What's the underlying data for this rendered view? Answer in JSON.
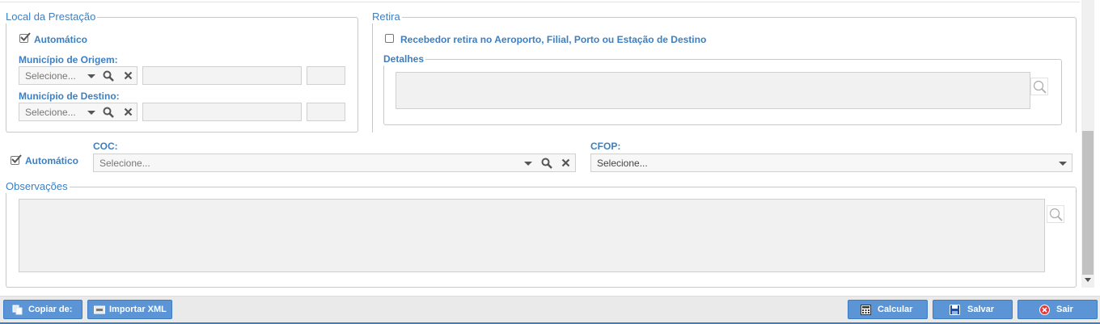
{
  "local_prestacao": {
    "legend": "Local da Prestação",
    "auto_label": "Automático",
    "auto_checked": true,
    "origem_label": "Município de Origem:",
    "origem_placeholder": "Selecione...",
    "destino_label": "Município de Destino:",
    "destino_placeholder": "Selecione..."
  },
  "retira": {
    "legend": "Retira",
    "checkbox_label": "Recebedor retira no Aeroporto, Filial, Porto ou Estação de Destino",
    "checked": false,
    "detalhes_legend": "Detalhes"
  },
  "fiscal": {
    "auto_label": "Automático",
    "auto_checked": true,
    "coc_label": "COC:",
    "coc_placeholder": "Selecione...",
    "cfop_label": "CFOP:",
    "cfop_placeholder": "Selecione..."
  },
  "observacoes": {
    "legend": "Observações"
  },
  "footer": {
    "copiar_label": "Copiar de:",
    "importar_label": "Importar XML",
    "calcular_label": "Calcular",
    "salvar_label": "Salvar",
    "sair_label": "Sair"
  },
  "colors": {
    "accent": "#3c7fc3",
    "button": "#5b95d6",
    "field_bg": "#f3f3f3"
  }
}
